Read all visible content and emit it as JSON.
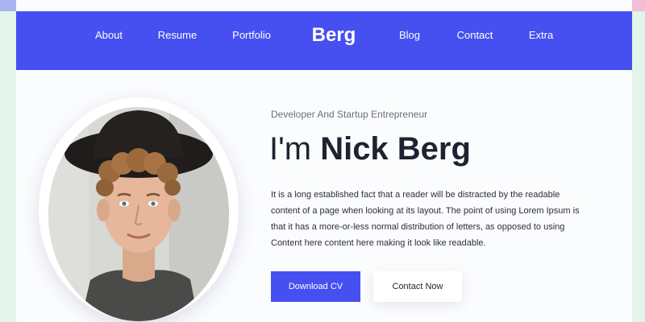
{
  "nav": {
    "items": [
      {
        "label": "About"
      },
      {
        "label": "Resume"
      },
      {
        "label": "Portfolio"
      },
      {
        "label": "Blog"
      },
      {
        "label": "Contact"
      },
      {
        "label": "Extra"
      }
    ],
    "brand": "Berg"
  },
  "hero": {
    "subtitle": "Developer And Startup Entrepreneur",
    "headline_prefix": "I'm ",
    "headline_name": "Nick Berg",
    "bio": "It is a long established fact that a reader will be distracted by the readable content of a page when looking at its layout. The point of using Lorem Ipsum is that it has a more-or-less normal distribution of letters, as opposed to using Content here content here making it look like readable.",
    "primary_button": "Download CV",
    "secondary_button": "Contact Now"
  },
  "colors": {
    "accent": "#4650f0",
    "text_dark": "#1f2230",
    "background": "#fbfcfd"
  }
}
